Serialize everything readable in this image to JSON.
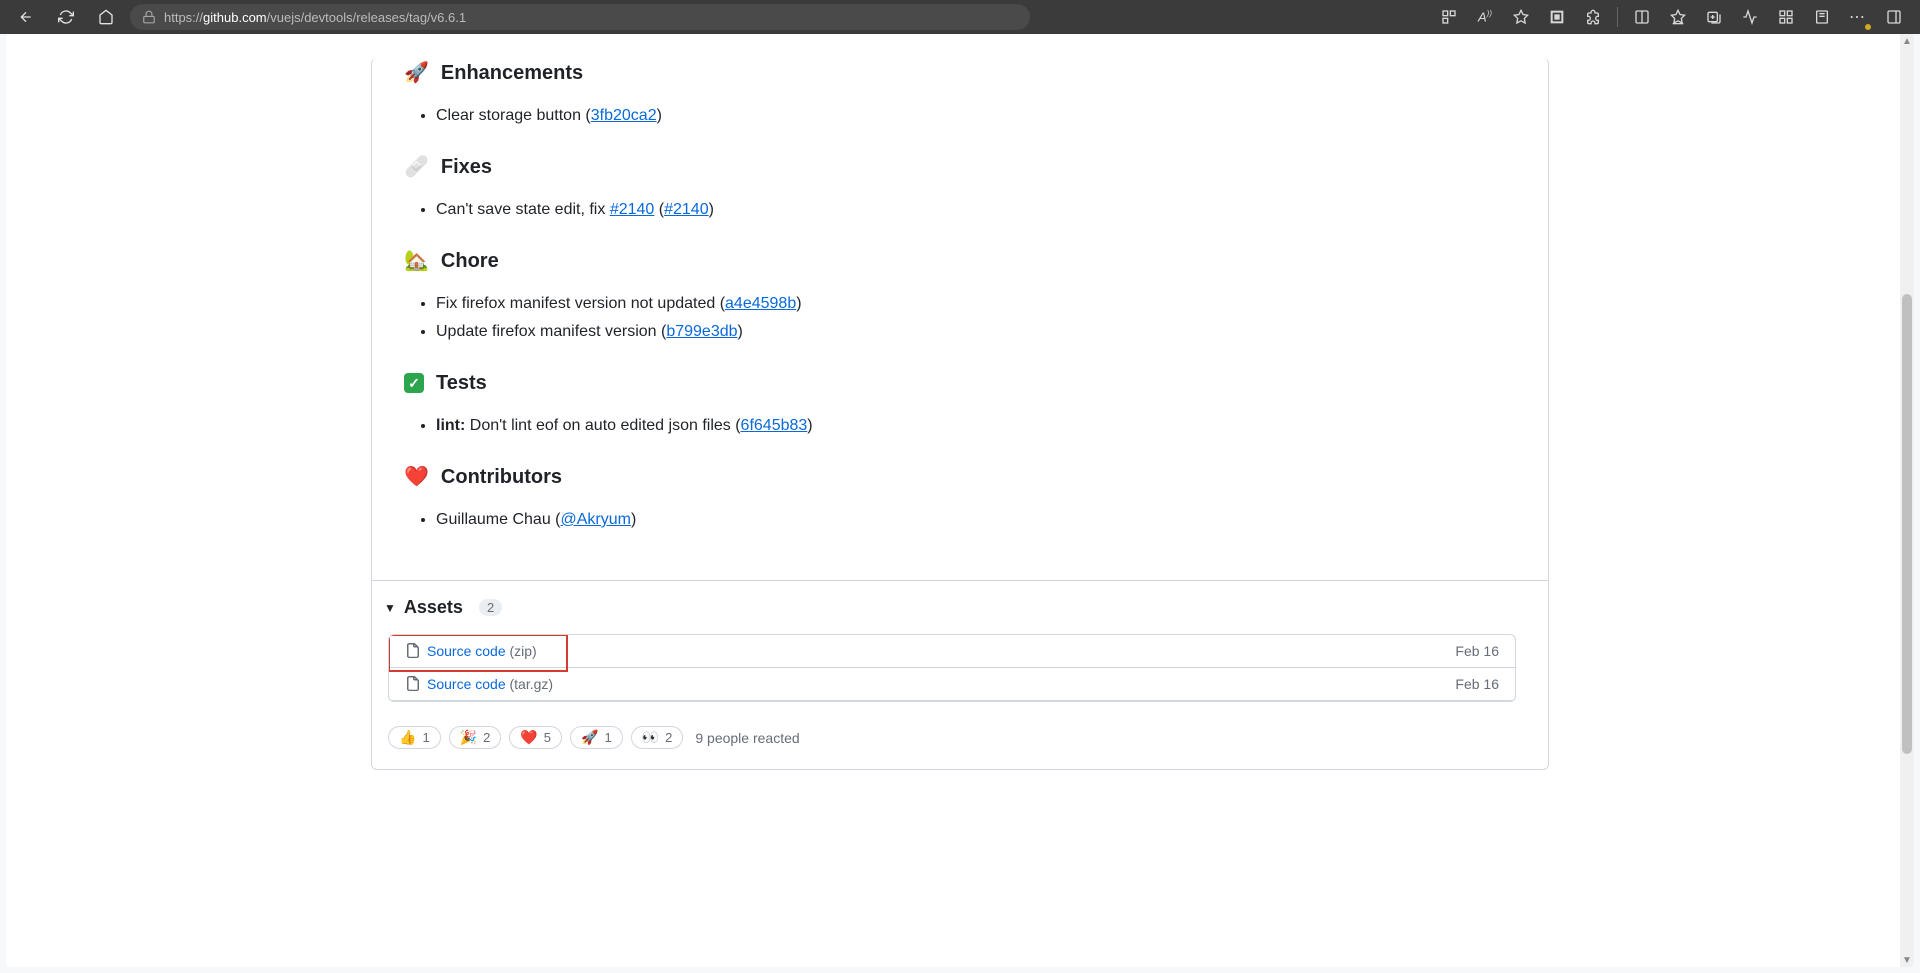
{
  "browser": {
    "url_prefix": "https://",
    "url_host": "github.com",
    "url_path": "/vuejs/devtools/releases/tag/v6.6.1"
  },
  "sections": {
    "enhancements": {
      "emoji": "🚀",
      "title": "Enhancements"
    },
    "fixes": {
      "emoji": "🩹",
      "title": "Fixes"
    },
    "chore": {
      "emoji": "🏡",
      "title": "Chore"
    },
    "tests": {
      "title": "Tests"
    },
    "contributors": {
      "emoji": "❤️",
      "title": "Contributors"
    }
  },
  "enh_item": {
    "text": "Clear storage button (",
    "link": "3fb20ca2",
    "close": ")"
  },
  "fix_item": {
    "text": "Can't save state edit, fix ",
    "link1": "#2140",
    "mid": " (",
    "link2": "#2140",
    "close": ")"
  },
  "chore1": {
    "text": "Fix firefox manifest version not updated (",
    "link": "a4e4598b",
    "close": ")"
  },
  "chore2": {
    "text": "Update firefox manifest version (",
    "link": "b799e3db",
    "close": ")"
  },
  "test_item": {
    "bold": "lint:",
    "text": " Don't lint eof on auto edited json files (",
    "link": "6f645b83",
    "close": ")"
  },
  "contrib": {
    "text": "Guillaume Chau (",
    "link": "@Akryum",
    "close": ")"
  },
  "assets": {
    "header": "Assets",
    "count": "2",
    "rows": [
      {
        "name": "Source code",
        "ext": "(zip)",
        "date": "Feb 16"
      },
      {
        "name": "Source code",
        "ext": "(tar.gz)",
        "date": "Feb 16"
      }
    ]
  },
  "reactions": [
    {
      "emoji": "👍",
      "count": "1"
    },
    {
      "emoji": "🎉",
      "count": "2"
    },
    {
      "emoji": "❤️",
      "count": "5"
    },
    {
      "emoji": "🚀",
      "count": "1"
    },
    {
      "emoji": "👀",
      "count": "2"
    }
  ],
  "reacted_text": "9 people reacted"
}
